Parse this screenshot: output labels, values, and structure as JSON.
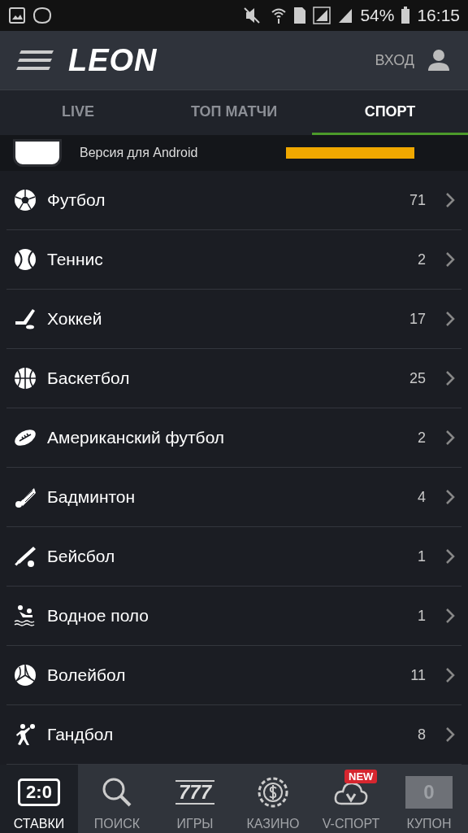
{
  "status_bar": {
    "battery": "54%",
    "time": "16:15"
  },
  "header": {
    "logo": "LEON",
    "login": "ВХОД"
  },
  "tabs": [
    {
      "label": "LIVE",
      "selected": false
    },
    {
      "label": "ТОП МАТЧИ",
      "selected": false
    },
    {
      "label": "СПОРТ",
      "selected": true
    }
  ],
  "banner": {
    "text": "Версия для Android"
  },
  "sports": [
    {
      "kind": "football",
      "name": "Футбол",
      "count": "71"
    },
    {
      "kind": "tennis",
      "name": "Теннис",
      "count": "2"
    },
    {
      "kind": "hockey",
      "name": "Хоккей",
      "count": "17"
    },
    {
      "kind": "basketball",
      "name": "Баскетбол",
      "count": "25"
    },
    {
      "kind": "rugby",
      "name": "Американский футбол",
      "count": "2"
    },
    {
      "kind": "badminton",
      "name": "Бадминтон",
      "count": "4"
    },
    {
      "kind": "baseball",
      "name": "Бейсбол",
      "count": "1"
    },
    {
      "kind": "waterpolo",
      "name": "Водное поло",
      "count": "1"
    },
    {
      "kind": "volleyball",
      "name": "Волейбол",
      "count": "11"
    },
    {
      "kind": "handball",
      "name": "Гандбол",
      "count": "8"
    }
  ],
  "bottom_nav": [
    {
      "kind": "score",
      "icon_text": "2:0",
      "label": "СТАВКИ",
      "selected": true
    },
    {
      "kind": "search",
      "label": "ПОИСК",
      "selected": false
    },
    {
      "kind": "slots",
      "icon_text": "777",
      "label": "ИГРЫ",
      "selected": false
    },
    {
      "kind": "casino",
      "label": "КАЗИНО",
      "selected": false
    },
    {
      "kind": "vsport",
      "badge": "NEW",
      "label": "V-СПОРТ",
      "selected": false
    },
    {
      "kind": "coupon",
      "icon_text": "0",
      "label": "КУПОН",
      "selected": false
    }
  ]
}
